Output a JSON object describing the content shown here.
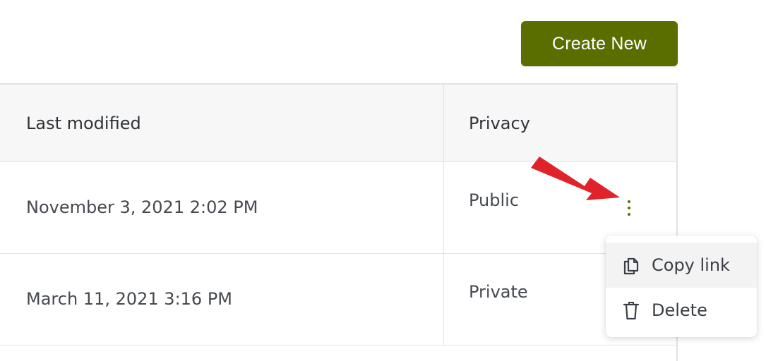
{
  "toolbar": {
    "create_label": "Create New"
  },
  "table": {
    "columns": [
      "Last modified",
      "Privacy"
    ],
    "rows": [
      {
        "modified": "November 3, 2021 2:02 PM",
        "privacy": "Public"
      },
      {
        "modified": "March 11, 2021 3:16 PM",
        "privacy": "Private"
      }
    ]
  },
  "context_menu": {
    "items": [
      {
        "label": "Copy link",
        "icon": "copy-icon"
      },
      {
        "label": "Delete",
        "icon": "trash-icon"
      }
    ]
  },
  "colors": {
    "accent": "#5a6e00",
    "annotation_arrow": "#e0222a"
  }
}
